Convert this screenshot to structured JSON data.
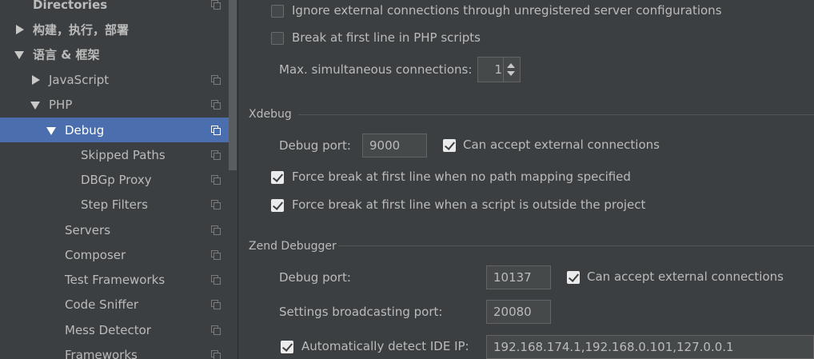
{
  "sidebar": {
    "items": [
      {
        "label": "Directories"
      },
      {
        "label": "构建，执行，部署"
      },
      {
        "label": "语言 & 框架"
      },
      {
        "label": "JavaScript"
      },
      {
        "label": "PHP"
      },
      {
        "label": "Debug"
      },
      {
        "label": "Skipped Paths"
      },
      {
        "label": "DBGp Proxy"
      },
      {
        "label": "Step Filters"
      },
      {
        "label": "Servers"
      },
      {
        "label": "Composer"
      },
      {
        "label": "Test Frameworks"
      },
      {
        "label": "Code Sniffer"
      },
      {
        "label": "Mess Detector"
      },
      {
        "label": "Frameworks"
      }
    ],
    "selected": "Debug"
  },
  "general": {
    "ignore_external_label": "Ignore external connections through unregistered server configurations",
    "ignore_external_checked": false,
    "break_first_line_label": "Break at first line in PHP scripts",
    "break_first_line_checked": false,
    "max_connections_label": "Max. simultaneous connections:",
    "max_connections_value": "1"
  },
  "xdebug": {
    "title": "Xdebug",
    "debug_port_label": "Debug port:",
    "debug_port_value": "9000",
    "accept_external_label": "Can accept external connections",
    "accept_external_checked": true,
    "force_break_no_mapping_label": "Force break at first line when no path mapping specified",
    "force_break_no_mapping_checked": true,
    "force_break_outside_label": "Force break at first line when a script is outside the project",
    "force_break_outside_checked": true
  },
  "zend": {
    "title": "Zend Debugger",
    "debug_port_label": "Debug port:",
    "debug_port_value": "10137",
    "accept_external_label": "Can accept external connections",
    "accept_external_checked": true,
    "broadcast_port_label": "Settings broadcasting port:",
    "broadcast_port_value": "20080",
    "auto_detect_ip_label": "Automatically detect IDE IP:",
    "auto_detect_ip_checked": true,
    "ide_ip_value": "192.168.174.1,192.168.0.101,127.0.0.1"
  },
  "icons": {
    "collapsed": "chevron-right-icon",
    "expanded": "chevron-down-icon",
    "project_settings": "copy-icon"
  },
  "colors": {
    "background": "#3c3f41",
    "selection": "#4b6eaf",
    "text": "#bbbbbb"
  }
}
